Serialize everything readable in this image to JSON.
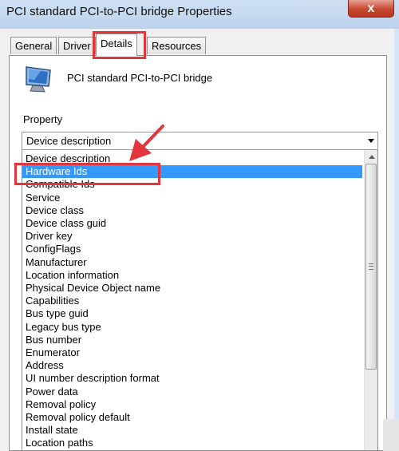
{
  "window": {
    "title": "PCI standard PCI-to-PCI bridge Properties",
    "close_label": "x"
  },
  "tabs": [
    {
      "label": "General",
      "active": false
    },
    {
      "label": "Driver",
      "active": false
    },
    {
      "label": "Details",
      "active": true
    },
    {
      "label": "Resources",
      "active": false
    }
  ],
  "device": {
    "name": "PCI standard PCI-to-PCI bridge",
    "icon": "computer-monitor-icon"
  },
  "property": {
    "label": "Property",
    "selected": "Device description",
    "options": [
      "Device description",
      "Hardware Ids",
      "Compatible Ids",
      "Service",
      "Device class",
      "Device class guid",
      "Driver key",
      "ConfigFlags",
      "Manufacturer",
      "Location information",
      "Physical Device Object name",
      "Capabilities",
      "Bus type guid",
      "Legacy bus type",
      "Bus number",
      "Enumerator",
      "Address",
      "UI number description format",
      "Power data",
      "Removal policy",
      "Removal policy default",
      "Install state",
      "Location paths"
    ],
    "highlighted": "Hardware Ids"
  },
  "annotation": {
    "color": "#e2363c"
  },
  "colors": {
    "selection": "#3399ff",
    "combo_border": "#6ea1d8"
  }
}
